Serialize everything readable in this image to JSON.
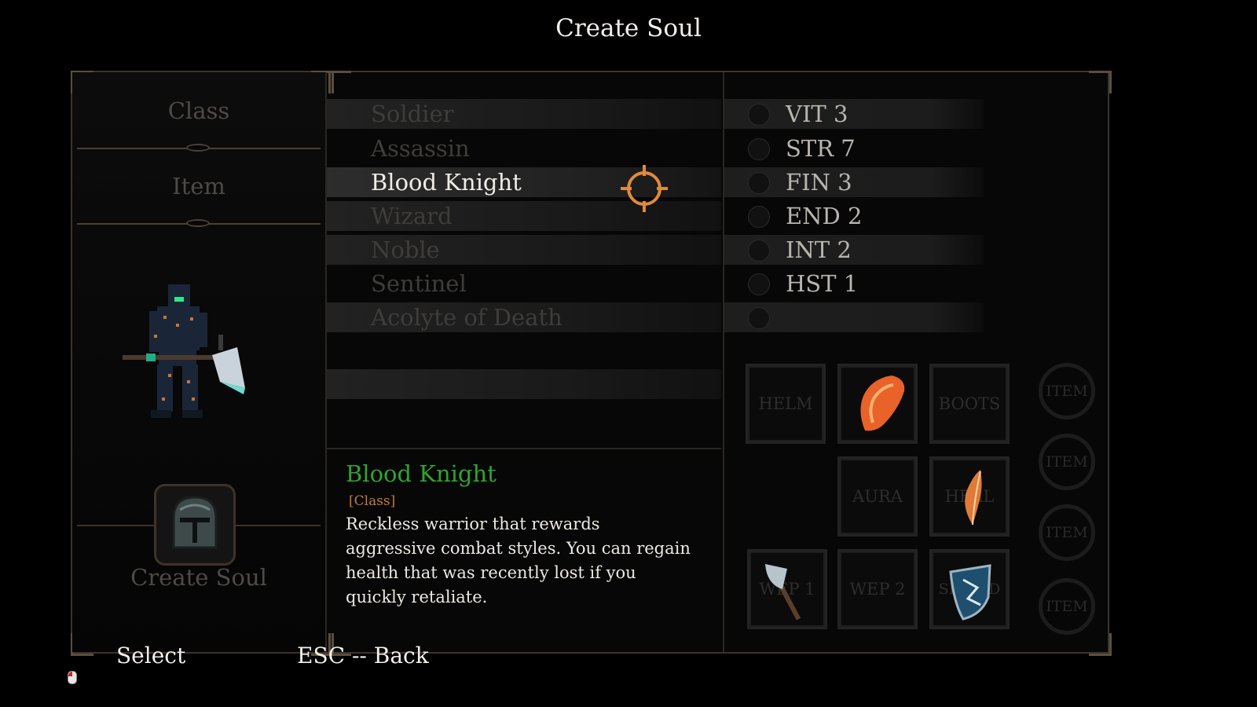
{
  "title": "Create Soul",
  "left_menu": {
    "class_label": "Class",
    "item_label": "Item",
    "create_label": "Create Soul"
  },
  "classes": [
    {
      "label": "Soldier"
    },
    {
      "label": "Assassin"
    },
    {
      "label": "Blood Knight",
      "selected": true
    },
    {
      "label": "Wizard"
    },
    {
      "label": "Noble"
    },
    {
      "label": "Sentinel"
    },
    {
      "label": "Acolyte of Death"
    }
  ],
  "description": {
    "name": "Blood Knight",
    "tag": "[Class]",
    "text": "Reckless warrior that rewards aggressive combat styles. You can regain health that was recently lost if you quickly retaliate."
  },
  "stats": [
    {
      "label": "VIT 3",
      "icon": "heart-icon"
    },
    {
      "label": "STR 7",
      "icon": "fist-icon"
    },
    {
      "label": "FIN 3",
      "icon": "crossed-blades-icon"
    },
    {
      "label": "END 2",
      "icon": "lungs-icon"
    },
    {
      "label": "INT 2",
      "icon": "brain-icon"
    },
    {
      "label": "HST 1",
      "icon": "clock-icon"
    }
  ],
  "slots": {
    "helm": "HELM",
    "armor": "",
    "boots": "BOOTS",
    "aura": "AURA",
    "heal": "HEAL",
    "wep1": "WEP 1",
    "wep2": "WEP 2",
    "shield": "SHIELD"
  },
  "item_rings": [
    "ITEM",
    "ITEM",
    "ITEM",
    "ITEM"
  ],
  "footer": {
    "select": "Select",
    "back": "ESC -- Back"
  },
  "colors": {
    "desc_name": "#2fa52a",
    "desc_tag": "#c27a3a",
    "cursor": "#e08a3c"
  }
}
